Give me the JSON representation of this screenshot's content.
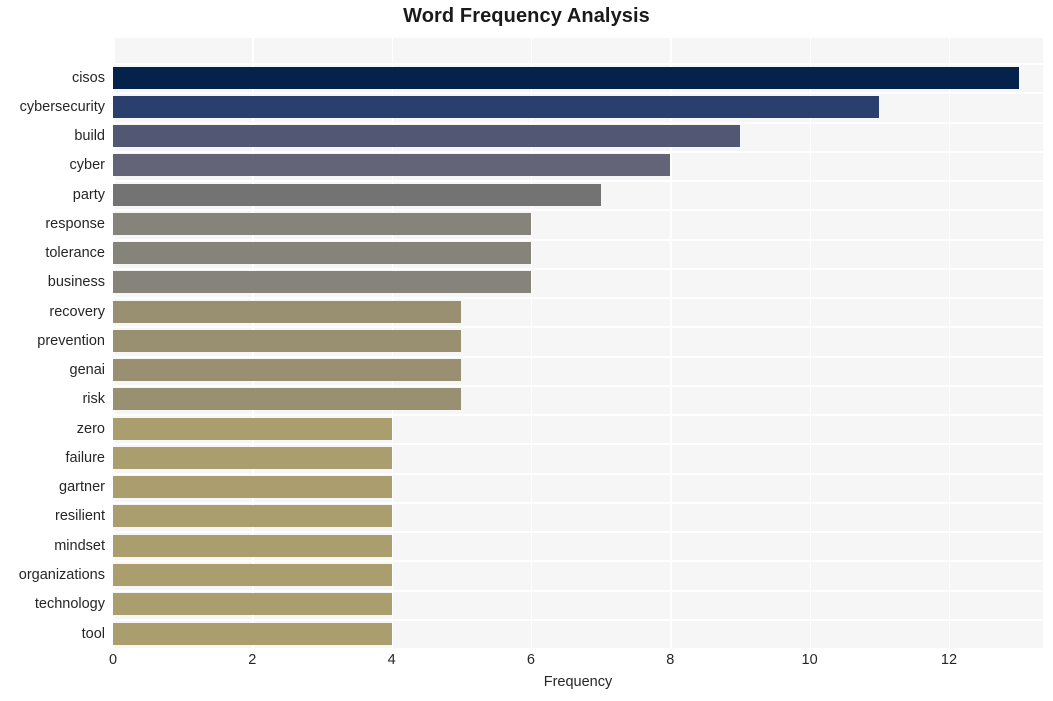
{
  "chart_data": {
    "type": "bar",
    "orientation": "horizontal",
    "title": "Word Frequency Analysis",
    "xlabel": "Frequency",
    "ylabel": "",
    "xlim": [
      0,
      13.35
    ],
    "xticks": [
      0,
      2,
      4,
      6,
      8,
      10,
      12
    ],
    "xticklabels": [
      "0",
      "2",
      "4",
      "6",
      "8",
      "10",
      "12"
    ],
    "grid": "vertical-white-on-light-gray",
    "legend": "none",
    "categories": [
      "cisos",
      "cybersecurity",
      "build",
      "cyber",
      "party",
      "response",
      "tolerance",
      "business",
      "recovery",
      "prevention",
      "genai",
      "risk",
      "zero",
      "failure",
      "gartner",
      "resilient",
      "mindset",
      "organizations",
      "technology",
      "tool"
    ],
    "values": [
      13,
      11,
      9,
      8,
      7,
      6,
      6,
      6,
      5,
      5,
      5,
      5,
      4,
      4,
      4,
      4,
      4,
      4,
      4,
      4
    ],
    "bar_colors": [
      "#04224a",
      "#2b3f6e",
      "#525873",
      "#636477",
      "#737373",
      "#86837b",
      "#86837b",
      "#86837b",
      "#989071",
      "#989071",
      "#989071",
      "#989071",
      "#aa9e6f",
      "#aa9e6f",
      "#aa9e6f",
      "#aa9e6f",
      "#aa9e6f",
      "#aa9e6f",
      "#aa9e6f",
      "#aa9e6f"
    ]
  },
  "style": {
    "figure_background": "#ffffff",
    "plot_background": "#f6f6f7",
    "gridline_color": "#ffffff",
    "text_color": "#262626",
    "title_color": "#1a1a1a"
  }
}
